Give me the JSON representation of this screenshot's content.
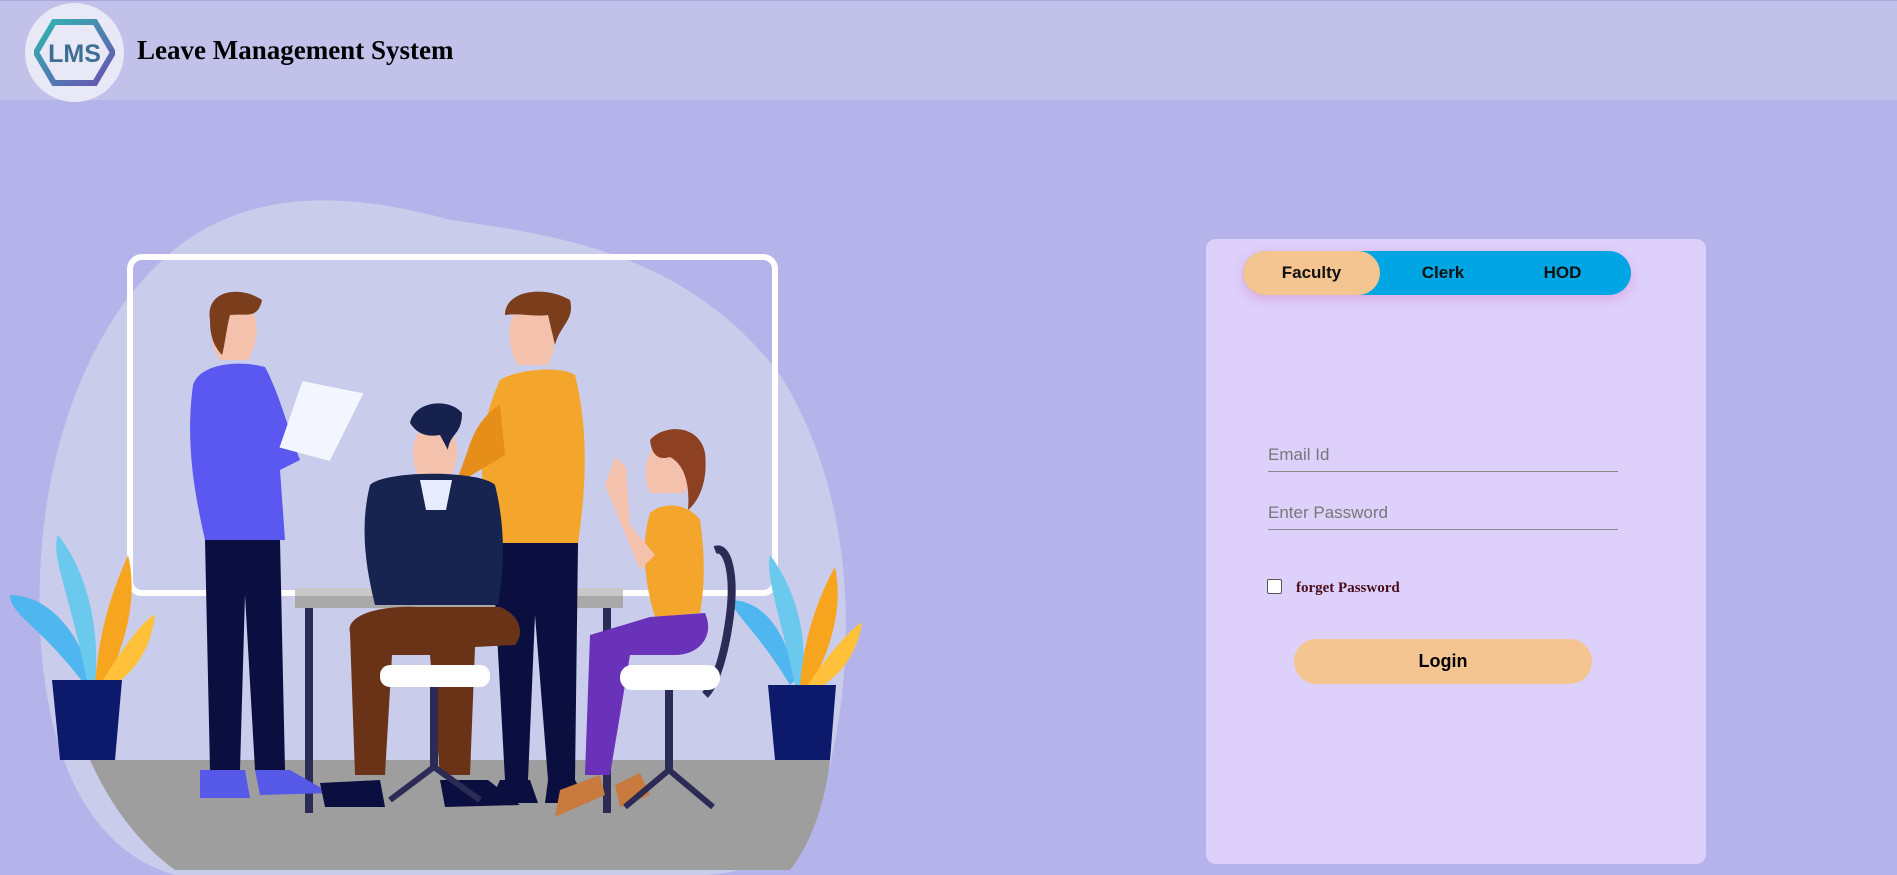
{
  "header": {
    "logo_text": "LMS",
    "title": "Leave Management System"
  },
  "login": {
    "tabs": [
      {
        "label": "Faculty",
        "active": true
      },
      {
        "label": "Clerk",
        "active": false
      },
      {
        "label": "HOD",
        "active": false
      }
    ],
    "email_placeholder": "Email Id",
    "password_placeholder": "Enter Password",
    "email_value": "",
    "password_value": "",
    "forget_label": "forget Password",
    "forget_checked": false,
    "login_label": "Login"
  },
  "colors": {
    "background": "#b5b4ea",
    "header": "#c2c1ea",
    "card": "#ddd1fb",
    "accent_peach": "#f5c591",
    "tab_blue": "#00a5e4"
  },
  "icons": {
    "logo": "lms-hexagon-logo",
    "illustration": "team-meeting-illustration"
  }
}
